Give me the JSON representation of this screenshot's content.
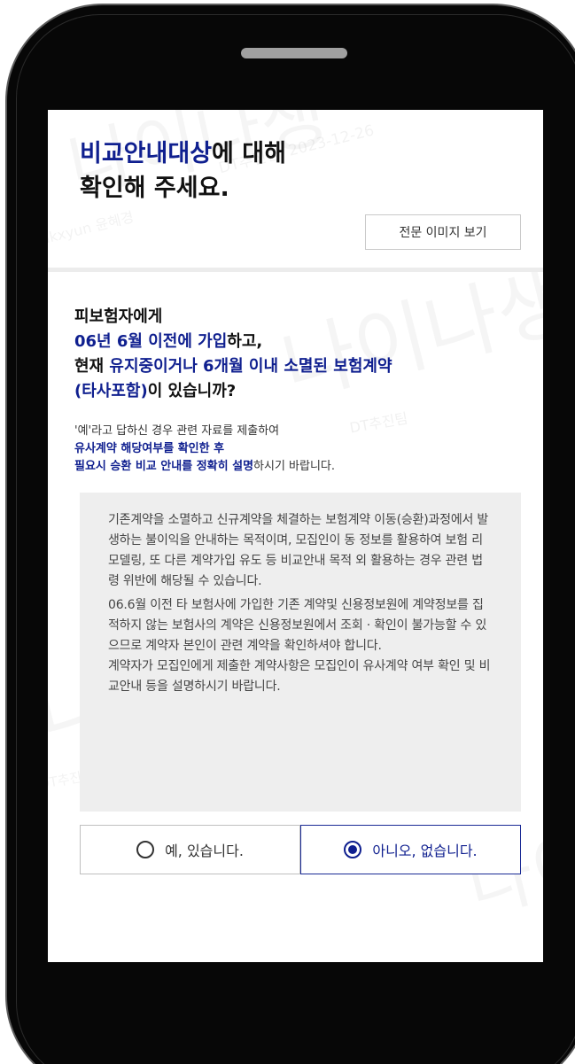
{
  "title": {
    "highlight": "비교안내대상",
    "rest_line1": "에 대해",
    "line2": "확인해 주세요."
  },
  "full_image_button": "전문 이미지 보기",
  "question": {
    "line1": "피보험자에게",
    "line2_highlight": "06년 6월 이전에 가입",
    "line2_rest": "하고,",
    "line3_prefix": "현재 ",
    "line3_highlight": "유지중이거나 6개월 이내 소멸된 보험계약",
    "line4_highlight": "(타사포함)",
    "line4_rest": "이 있습니까?"
  },
  "note": {
    "line1": "'예'라고 답하신 경우 관련 자료를 제출하여",
    "line2_highlight": "유사계약 해당여부를 확인한 후",
    "line3_highlight": "필요시 승환 비교 안내를 정확히 설명",
    "line3_rest": "하시기 바랍니다."
  },
  "info": {
    "paragraph1": "기존계약을 소멸하고 신규계약을 체결하는 보험계약 이동(승환)과정에서 발생하는 불이익을 안내하는 목적이며, 모집인이 동 정보를 활용하여 보험 리모델링, 또 다른 계약가입 유도 등 비교안내 목적 외 활용하는 경우 관련 법령 위반에 해당될 수 있습니다.",
    "paragraph2": "06.6월 이전 타 보험사에 가입한 기존 계약및 신용정보원에 계약정보를 집적하지 않는 보험사의 계약은 신용정보원에서 조회 · 확인이 불가능할 수 있으므로 계약자 본인이 관련 계약을 확인하셔야 합니다.",
    "paragraph3": "계약자가 모집인에게 제출한 계약사항은 모집인이 유사계약 여부 확인 및 비교안내 등을 설명하시기 바랍니다."
  },
  "choices": {
    "yes_label": "예, 있습니다.",
    "no_label": "아니오, 없습니다.",
    "selected": "no"
  },
  "watermark": {
    "large_text": "나이나생",
    "id_text": "nkxyun 윤혜경",
    "team_text": "DT추진팀",
    "date_text": "2023-12-26"
  },
  "colors": {
    "accent": "#0f1f8f",
    "info_background": "#eeeeee",
    "phone_body": "#070707"
  }
}
